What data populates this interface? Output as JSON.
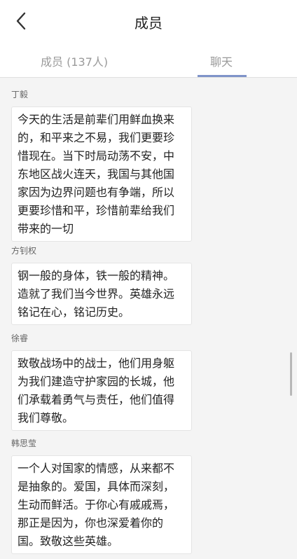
{
  "header": {
    "title": "成员"
  },
  "tabs": [
    {
      "label": "成员 (137人)"
    },
    {
      "label": "聊天"
    }
  ],
  "messages": [
    {
      "sender": "丁毅",
      "text": "今天的生活是前辈们用鲜血换来的，和平来之不易，我们更要珍惜现在。当下时局动荡不安，中东地区战火连天，我国与其他国家因为边界问题也有争端，所以更要珍惜和平，珍惜前辈给我们带来的一切"
    },
    {
      "sender": "方钊权",
      "text": "钢一般的身体，铁一般的精神。造就了我们当今世界。英雄永远铭记在心，铭记历史。"
    },
    {
      "sender": "徐睿",
      "text": "致敬战场中的战士，他们用身躯为我们建造守护家园的长城，他们承载着勇气与责任，他们值得我们尊敬。"
    },
    {
      "sender": "韩思莹",
      "text": "一个人对国家的情感，从来都不是抽象的。爱国，具体而深刻，生动而鲜活。于你心有戚戚焉，那正是因为，你也深爱着你的国。致敬这些英雄。"
    }
  ]
}
